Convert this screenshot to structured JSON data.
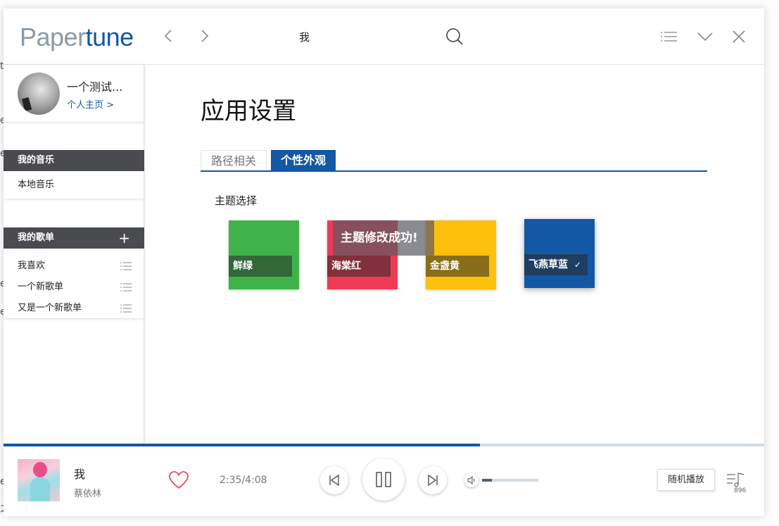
{
  "app": {
    "logo_part1": "Paper",
    "logo_part2": "tune",
    "title": "我"
  },
  "backdrop_chars": [
    "t",
    "e",
    "e",
    "e",
    "e",
    "e",
    "之"
  ],
  "profile": {
    "name": "一个测试...",
    "link": "个人主页 >"
  },
  "sidebar": {
    "my_music_header": "我的音乐",
    "local_music": "本地音乐",
    "my_playlists_header": "我的歌单",
    "add_symbol": "+",
    "playlists": [
      {
        "label": "我喜欢"
      },
      {
        "label": "一个新歌单"
      },
      {
        "label": "又是一个新歌单"
      }
    ]
  },
  "settings": {
    "page_title": "应用设置",
    "tabs": [
      {
        "label": "路径相关",
        "active": false
      },
      {
        "label": "个性外观",
        "active": true
      }
    ],
    "theme_section_label": "主题选择",
    "themes": [
      {
        "label": "鲜绿",
        "color": "#3fb34a",
        "selected": false
      },
      {
        "label": "海棠红",
        "color": "#ef3a56",
        "selected": false
      },
      {
        "label": "金盏黄",
        "color": "#fdc00c",
        "selected": false
      },
      {
        "label": "飞燕草蓝",
        "color": "#1258a5",
        "selected": true,
        "check": "✓"
      }
    ],
    "toast": "主题修改成功!"
  },
  "player": {
    "song_title": "我",
    "artist": "蔡依林",
    "time": "2:35/4:08",
    "progress": 0.626,
    "volume": 0.18,
    "mode": "随机播放",
    "queue_count": "896",
    "accent": "#1258a5"
  }
}
